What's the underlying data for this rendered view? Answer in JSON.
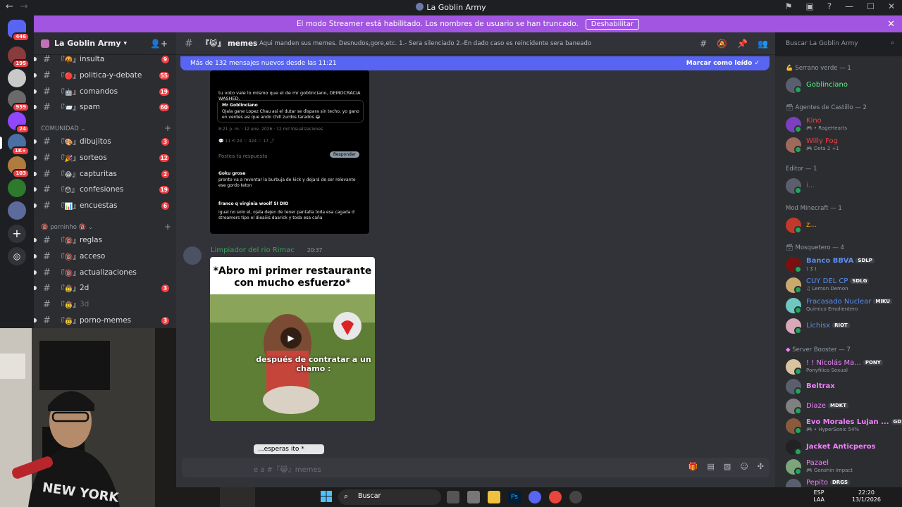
{
  "window": {
    "title": "La Goblin Army"
  },
  "banner": {
    "text": "El modo Streamer está habilitado. Los nombres de usuario se han truncado.",
    "button": "Deshabilitar"
  },
  "servers": [
    {
      "badge": "446"
    },
    {
      "badge": "195"
    },
    {
      "badge": ""
    },
    {
      "badge": "959"
    },
    {
      "badge": "24"
    },
    {
      "badge": "1K+"
    },
    {
      "badge": "103"
    },
    {
      "badge": ""
    },
    {
      "badge": ""
    }
  ],
  "server": {
    "name": "La Goblin Army"
  },
  "channels_top": [
    {
      "name": "insulta",
      "badge": "9",
      "emoji": "『🤬』"
    },
    {
      "name": "politica-y-debate",
      "badge": "55",
      "emoji": "『🔴』"
    },
    {
      "name": "comandos",
      "badge": "19",
      "emoji": "『🤖』"
    },
    {
      "name": "spam",
      "badge": "60",
      "emoji": "『📨』"
    }
  ],
  "category_comunidad": "COMUNIDAD",
  "channels_comunidad": [
    {
      "name": "dibujitos",
      "badge": "3",
      "emoji": "『🎨』"
    },
    {
      "name": "sorteos",
      "badge": "12",
      "emoji": "『🎉』"
    },
    {
      "name": "capturitas",
      "badge": "2",
      "emoji": "『😂』"
    },
    {
      "name": "confesiones",
      "badge": "19",
      "emoji": "『😯』"
    },
    {
      "name": "encuestas",
      "badge": "6",
      "emoji": "『📊』"
    }
  ],
  "category_porninho": "🔞 porninho 🔞",
  "channels_porninho": [
    {
      "name": "reglas",
      "badge": "",
      "emoji": "『🔞』"
    },
    {
      "name": "acceso",
      "badge": "",
      "emoji": "『🔞』"
    },
    {
      "name": "actualizaciones",
      "badge": "",
      "emoji": "『🔞』"
    },
    {
      "name": "2d",
      "badge": "3",
      "emoji": "『🤠』"
    },
    {
      "name": "3d",
      "badge": "",
      "emoji": "『🤠』"
    },
    {
      "name": "porno-memes",
      "badge": "3",
      "emoji": "『🤠』"
    }
  ],
  "channel": {
    "name": "memes",
    "emoji": "『😹』",
    "topic": "Aqui manden sus memes. Desnudos,gore,etc. 1.- Sera silenciado 2.-En dado caso es reincidente sera baneado"
  },
  "search_placeholder": "Buscar La Goblin Army",
  "new_messages": {
    "text": "Más de 132 mensajes nuevos desde las 11:21",
    "mark": "Marcar como leído"
  },
  "tweet": {
    "line1": "tu voto vale lo mismo que el de mr goblinciano, DEMOCRACIA WASHED.",
    "quote_author": "Mr Goblinciano",
    "quote_text": "Ojala gane Lopez Chau asi el dutar se dispara sin techo, yo gano en verdes asi que ando chill zurdos tarados 😂",
    "meta": "8:21 p. m. · 12 ene. 2026 · 12 mil Visualizaciones",
    "reply_placeholder": "Postea tu respuesta",
    "reply_btn": "Responder",
    "reply1_author": "Goku grose",
    "reply1": "pronto va a reventar la burbuja de kick y dejará de ser relevante ese gordo teton",
    "reply2_author": "franco q virginia woolf SI DIO",
    "reply2": "igual no solo el, ojala dejen de tener pantalla toda esa cagada d streamers tipo el dieaiiis daarick y toda esa caña"
  },
  "message": {
    "author": "Limpiador del rio Rimac",
    "time": "20:37",
    "caption": "*Abro mi primer restaurante con mucho esfuerzo*",
    "subtitle": "después de contratar a un chamo :",
    "tail": "...esperas ito *"
  },
  "composer": {
    "placeholder": "e a #『😹』memes"
  },
  "members": {
    "groups": [
      {
        "title": "Serrano verde — 1",
        "members": [
          {
            "name": "Goblinciano",
            "status": "",
            "tag": "",
            "color": "#57f287"
          }
        ]
      },
      {
        "title": "Agentes de Castillo — 2",
        "members": [
          {
            "name": "Kino",
            "status": "• RageHearts",
            "tag": "",
            "color": "#f23f43"
          },
          {
            "name": "Willy Fog",
            "status": "Dota 2 +1",
            "tag": "",
            "color": "#f23f43"
          }
        ]
      },
      {
        "title": "Editor — 1",
        "members": [
          {
            "name": "i...",
            "status": "",
            "tag": "",
            "color": "#f23f43"
          }
        ]
      },
      {
        "title": "Mod Minecraft — 1",
        "members": [
          {
            "name": "z...",
            "status": "",
            "tag": "",
            "color": "#faa81a"
          }
        ]
      },
      {
        "title": "Mosquetero — 4",
        "members": [
          {
            "name": "Banco BBVA",
            "status": "ʅ ʒ ʅ",
            "tag": "SDLP",
            "color": "#5b8def"
          },
          {
            "name": "CUY DEL CP",
            "status": "Lemon Demon",
            "tag": "SDLG",
            "color": "#5b8def"
          },
          {
            "name": "Fracasado Nuclear",
            "status": "Quimico Emolientero",
            "tag": "MIKU",
            "color": "#5b8def"
          },
          {
            "name": "Lichisx",
            "status": "",
            "tag": "RIOT",
            "color": "#5b8def"
          }
        ]
      },
      {
        "title": "Server Booster — 7",
        "members": [
          {
            "name": "! ! Nicolás Ma...",
            "status": "Ponyfilico Sexual",
            "tag": "PONY",
            "color": "#f47fff"
          },
          {
            "name": "Beltrax",
            "status": "",
            "tag": "",
            "color": "#f47fff"
          },
          {
            "name": "Diaze",
            "status": "",
            "tag": "MDKT",
            "color": "#f47fff"
          },
          {
            "name": "Evo Morales Lujan ...",
            "status": "• HyperSonic 54%",
            "tag": "GD",
            "color": "#f47fff"
          },
          {
            "name": "Jacket Anticperos",
            "status": "",
            "tag": "",
            "color": "#f47fff"
          },
          {
            "name": "Pazael",
            "status": "Genshin Impact",
            "tag": "",
            "color": "#f47fff"
          },
          {
            "name": "Pepito",
            "status": "",
            "tag": "DRGS",
            "color": "#f47fff"
          }
        ]
      }
    ]
  },
  "taskbar": {
    "search": "Buscar",
    "lang1": "ESP",
    "lang2": "LAA",
    "time": "22:20",
    "date": "13/1/2026"
  }
}
